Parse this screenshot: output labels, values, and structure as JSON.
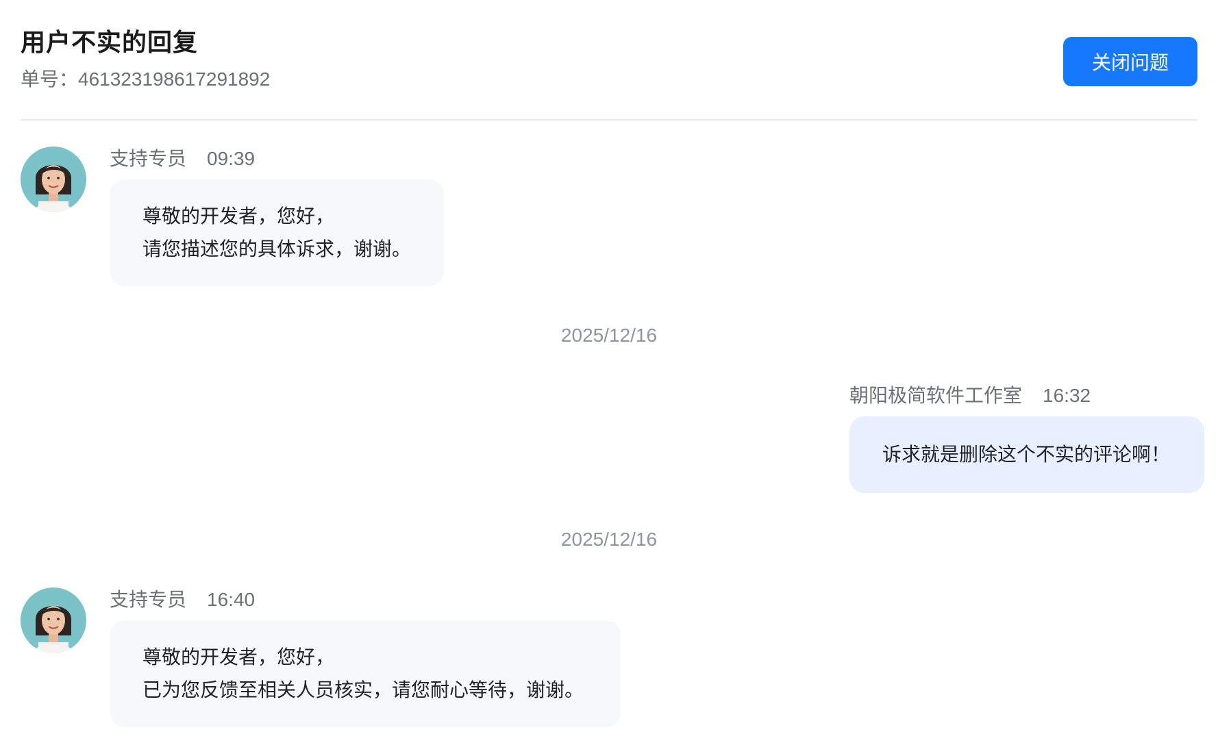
{
  "header": {
    "title": "用户不实的回复",
    "ticket_label": "单号：",
    "ticket_number": "461323198617291892",
    "close_button": "关闭问题"
  },
  "colors": {
    "primary": "#1677ff",
    "support_bubble": "#f7f8fa",
    "user_bubble": "#e8efff",
    "muted_text": "#6b6f76"
  },
  "messages": [
    {
      "sender": "支持专员",
      "time": "09:39",
      "lines": [
        "尊敬的开发者，您好，",
        "请您描述您的具体诉求，谢谢。"
      ],
      "avatar_icon": "support-agent-avatar"
    },
    {
      "date": "2025/12/16"
    },
    {
      "sender": "朝阳极简软件工作室",
      "time": "16:32",
      "lines": [
        "诉求就是删除这个不实的评论啊！"
      ]
    },
    {
      "date": "2025/12/16"
    },
    {
      "sender": "支持专员",
      "time": "16:40",
      "lines": [
        "尊敬的开发者，您好，",
        "已为您反馈至相关人员核实，请您耐心等待，谢谢。"
      ],
      "avatar_icon": "support-agent-avatar"
    }
  ]
}
